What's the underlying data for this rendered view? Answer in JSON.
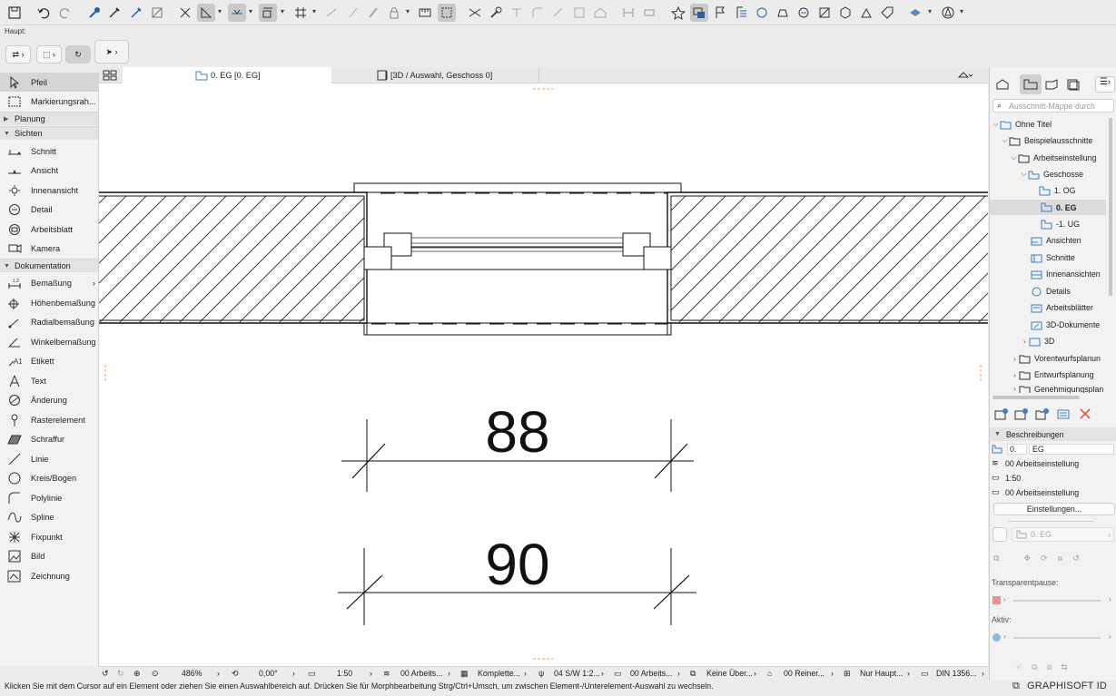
{
  "panel": {
    "haupt_label": "Haupt:"
  },
  "toolbox": {
    "groups": {
      "planung": "Planung",
      "sichten": "Sichten",
      "dokumentation": "Dokumentation"
    },
    "tools": {
      "pfeil": "Pfeil",
      "markierung": "Markierungsrah...",
      "schnitt": "Schnitt",
      "ansicht": "Ansicht",
      "innenansicht": "Innenansicht",
      "detail": "Detail",
      "arbeitsblatt": "Arbeitsblatt",
      "kamera": "Kamera",
      "bemassung": "Bemaßung",
      "hoehenbemassung": "Höhenbemaßung",
      "radialbemassung": "Radialbemaßung",
      "winkelbemassung": "Winkelbemaßung",
      "etikett": "Etikett",
      "text": "Text",
      "aenderung": "Änderung",
      "rasterelement": "Rasterelement",
      "schraffur": "Schraffur",
      "linie": "Linie",
      "kreis": "Kreis/Bogen",
      "polylinie": "Polylinie",
      "spline": "Spline",
      "fixpunkt": "Fixpunkt",
      "bild": "Bild",
      "zeichnung": "Zeichnung"
    }
  },
  "tabs": {
    "floorplan": "0. EG [0. EG]",
    "view3d": "[3D / Auswahl, Geschoss 0]"
  },
  "drawing": {
    "dim_upper": "88",
    "dim_lower": "90"
  },
  "statusbar": {
    "zoom": "486%",
    "angle": "0,00°",
    "scale": "1:50",
    "layers": "00 Arbeits...",
    "model": "Komplette...",
    "pen": "04 S/W 1:2...",
    "view": "00 Arbeits...",
    "override": "Keine Über...",
    "reno": "00 Reiner...",
    "structure": "Nur Haupt...",
    "paper": "DIN 1356..."
  },
  "hint": "Klicken Sie mit dem Cursor auf ein Element oder ziehen Sie einen Auswahlbereich auf. Drücken Sie für Morphbearbeitung Strg/Ctrl+Umsch, um zwischen Element-/Unterelement-Auswahl zu wechseln.",
  "brand": "GRAPHISOFT ID",
  "navigator": {
    "search_placeholder": "Ausschnitt-Mappe durch",
    "tree": {
      "root": "Ohne Titel",
      "beispiel": "Beispielausschnitte",
      "arbeitseinstellung": "Arbeitseinstellung",
      "geschosse": "Geschosse",
      "og1": "1. OG",
      "eg0": "0. EG",
      "ug1": "-1. UG",
      "ansichten": "Ansichten",
      "schnitte": "Schnitte",
      "innenansichten": "Innenansichten",
      "details": "Details",
      "arbeitsblaetter": "Arbeitsblätter",
      "dokumente3d": "3D-Dokumente",
      "d3": "3D",
      "vorentwurf": "Vorentwurfsplanun",
      "entwurf": "Entwurfsplanung",
      "genehmigung": "Genehmigungsplan"
    },
    "props": {
      "header": "Beschreibungen",
      "id": "0.",
      "name": "EG",
      "layer": "00 Arbeitseinstellung",
      "scale": "1:50",
      "view": "00 Arbeitseinstellung",
      "settings_button": "Einstellungen...",
      "story": "0. EG",
      "transparent_label": "Transparentpause:",
      "active_label": "Aktiv:"
    }
  },
  "colors": {
    "accent": "#3b7fc4",
    "delete": "#e05a4a",
    "swatch": "#f0908a"
  }
}
